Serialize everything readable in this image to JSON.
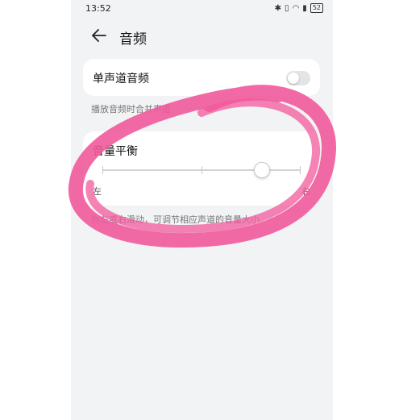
{
  "status": {
    "time": "13:52",
    "icons": [
      "bluetooth-icon",
      "vibrate-icon",
      "wifi-icon",
      "signal-icon"
    ],
    "battery": "52"
  },
  "header": {
    "back_icon": "arrow-left-icon",
    "title": "音频"
  },
  "mono": {
    "label": "单声道音频",
    "enabled": false
  },
  "hint_mono": "播放音频时合并声道",
  "balance": {
    "label": "音量平衡",
    "left": "左",
    "right": "右",
    "value": 0.8
  },
  "hint_balance": "向左或右滑动，可调节相应声道的音量大小",
  "colors": {
    "annotation": "#f15a9b",
    "background": "#f2f3f5",
    "card": "#ffffff"
  }
}
